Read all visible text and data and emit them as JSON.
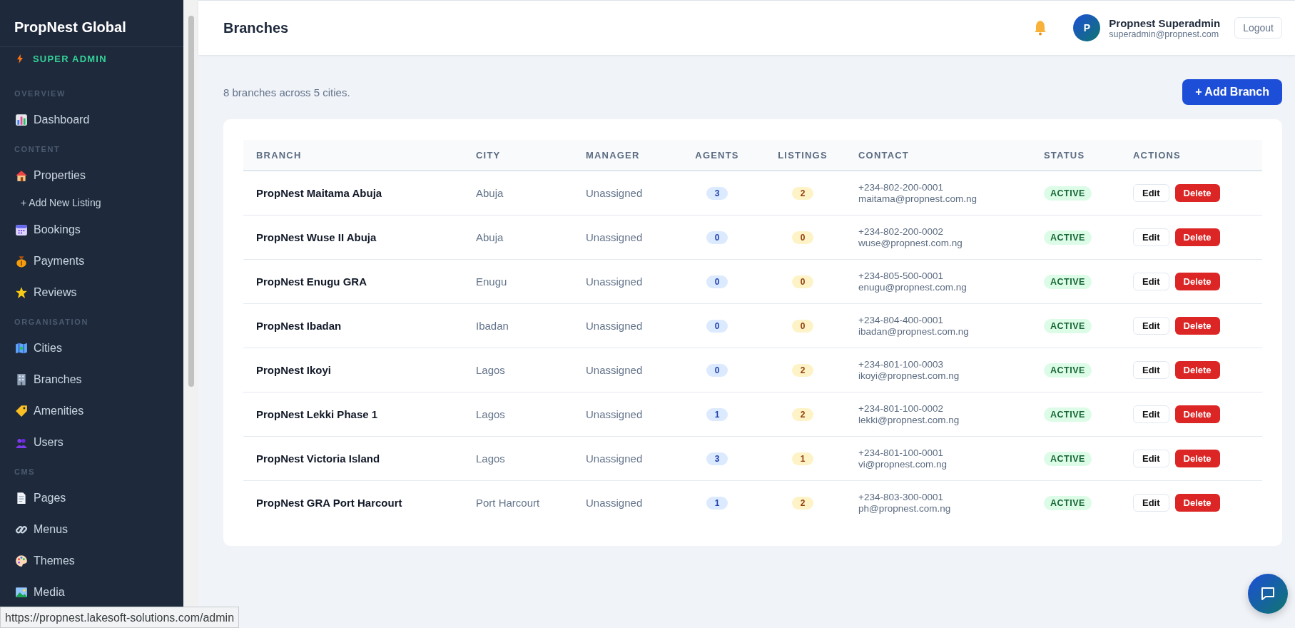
{
  "sidebar": {
    "brand": "PropNest Global",
    "role": "SUPER ADMIN",
    "sections": [
      {
        "heading": "OVERVIEW",
        "items": [
          {
            "label": "Dashboard",
            "kind": "link"
          }
        ]
      },
      {
        "heading": "CONTENT",
        "items": [
          {
            "label": "Properties",
            "kind": "link"
          },
          {
            "label": "+ Add New Listing",
            "kind": "sub"
          },
          {
            "label": "Bookings",
            "kind": "link"
          },
          {
            "label": "Payments",
            "kind": "link"
          },
          {
            "label": "Reviews",
            "kind": "link"
          }
        ]
      },
      {
        "heading": "ORGANISATION",
        "items": [
          {
            "label": "Cities",
            "kind": "link"
          },
          {
            "label": "Branches",
            "kind": "link"
          },
          {
            "label": "Amenities",
            "kind": "link"
          },
          {
            "label": "Users",
            "kind": "link"
          }
        ]
      },
      {
        "heading": "CMS",
        "items": [
          {
            "label": "Pages",
            "kind": "link"
          },
          {
            "label": "Menus",
            "kind": "link"
          },
          {
            "label": "Themes",
            "kind": "link"
          },
          {
            "label": "Media",
            "kind": "link"
          }
        ]
      }
    ]
  },
  "header": {
    "title": "Branches",
    "user": {
      "initial": "P",
      "name": "Propnest Superadmin",
      "email": "superadmin@propnest.com"
    },
    "logout": "Logout"
  },
  "summary": "8 branches across 5 cities.",
  "add_button": "+ Add Branch",
  "table": {
    "columns": [
      "BRANCH",
      "CITY",
      "MANAGER",
      "AGENTS",
      "LISTINGS",
      "CONTACT",
      "STATUS",
      "ACTIONS"
    ],
    "rows": [
      {
        "branch": "PropNest Maitama Abuja",
        "city": "Abuja",
        "manager": "Unassigned",
        "agents": "3",
        "listings": "2",
        "phone": "+234-802-200-0001",
        "email": "maitama@propnest.com.ng",
        "status": "ACTIVE",
        "active": true,
        "edit": "Edit",
        "delete": "Delete"
      },
      {
        "branch": "PropNest Wuse II Abuja",
        "city": "Abuja",
        "manager": "Unassigned",
        "agents": "0",
        "listings": "0",
        "phone": "+234-802-200-0002",
        "email": "wuse@propnest.com.ng",
        "status": "ACTIVE",
        "active": true,
        "edit": "Edit",
        "delete": "Delete"
      },
      {
        "branch": "PropNest Enugu GRA",
        "city": "Enugu",
        "manager": "Unassigned",
        "agents": "0",
        "listings": "0",
        "phone": "+234-805-500-0001",
        "email": "enugu@propnest.com.ng",
        "status": "ACTIVE",
        "active": true,
        "edit": "Edit",
        "delete": "Delete"
      },
      {
        "branch": "PropNest Ibadan",
        "city": "Ibadan",
        "manager": "Unassigned",
        "agents": "0",
        "listings": "0",
        "phone": "+234-804-400-0001",
        "email": "ibadan@propnest.com.ng",
        "status": "ACTIVE",
        "active": true,
        "edit": "Edit",
        "delete": "Delete"
      },
      {
        "branch": "PropNest Ikoyi",
        "city": "Lagos",
        "manager": "Unassigned",
        "agents": "0",
        "listings": "2",
        "phone": "+234-801-100-0003",
        "email": "ikoyi@propnest.com.ng",
        "status": "ACTIVE",
        "active": true,
        "edit": "Edit",
        "delete": "Delete"
      },
      {
        "branch": "PropNest Lekki Phase 1",
        "city": "Lagos",
        "manager": "Unassigned",
        "agents": "1",
        "listings": "2",
        "phone": "+234-801-100-0002",
        "email": "lekki@propnest.com.ng",
        "status": "ACTIVE",
        "active": true,
        "edit": "Edit",
        "delete": "Delete"
      },
      {
        "branch": "PropNest Victoria Island",
        "city": "Lagos",
        "manager": "Unassigned",
        "agents": "3",
        "listings": "1",
        "phone": "+234-801-100-0001",
        "email": "vi@propnest.com.ng",
        "status": "ACTIVE",
        "active": true,
        "edit": "Edit",
        "delete": "Delete"
      },
      {
        "branch": "PropNest GRA Port Harcourt",
        "city": "Port Harcourt",
        "manager": "Unassigned",
        "agents": "1",
        "listings": "2",
        "phone": "+234-803-300-0001",
        "email": "ph@propnest.com.ng",
        "status": "ACTIVE",
        "active": true,
        "edit": "Edit",
        "delete": "Delete"
      }
    ]
  },
  "status_url": "https://propnest.lakesoft-solutions.com/admin"
}
